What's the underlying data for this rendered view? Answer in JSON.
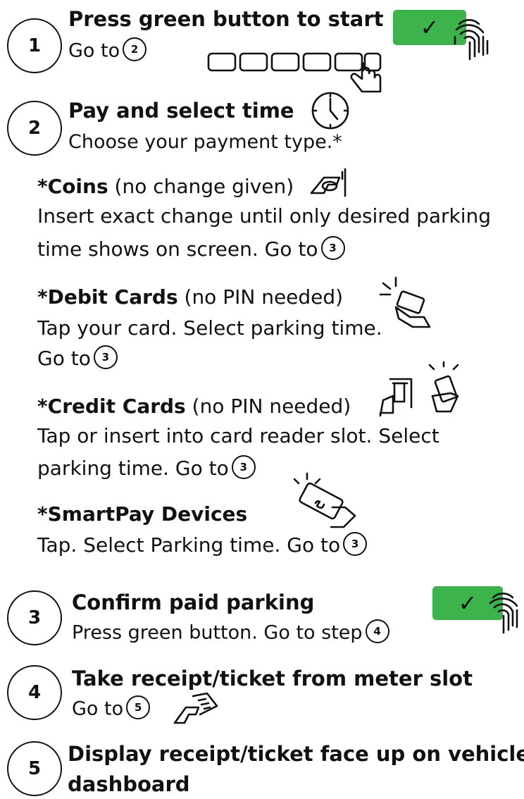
{
  "steps": [
    {
      "number": "1",
      "title": "Press green button to start",
      "goto": "Go to",
      "goto_num": "2"
    },
    {
      "number": "2",
      "title": "Pay and select time",
      "desc": "Choose your payment type.*"
    },
    {
      "number": "3",
      "title": "Confirm paid parking",
      "desc": "Press green button. Go to step",
      "goto_num": "4"
    },
    {
      "number": "4",
      "title": "Take receipt/ticket from meter slot",
      "goto": "Go to",
      "goto_num": "5"
    },
    {
      "number": "5",
      "title_line1": "Display receipt/ticket face up on vehicle",
      "title_line2": "dashboard"
    }
  ],
  "payments": {
    "coins": {
      "name": "*Coins",
      "note": "(no change given)",
      "line1": "Insert exact change until only desired parking",
      "line2": "time shows on screen. Go to",
      "goto_num": "3"
    },
    "debit": {
      "name": "*Debit Cards",
      "note": "(no PIN needed)",
      "line1": "Tap your card. Select parking time.",
      "line2": "Go to",
      "goto_num": "3"
    },
    "credit": {
      "name": "*Credit Cards",
      "note": "(no PIN needed)",
      "line1": "Tap or insert into card reader slot. Select",
      "line2": "parking time. Go to",
      "goto_num": "3"
    },
    "smartpay": {
      "name": "*SmartPay Devices",
      "line1": "Tap. Select Parking time. Go to",
      "goto_num": "3"
    }
  },
  "icons": {
    "check": "✓",
    "green": "#3cb44b"
  }
}
